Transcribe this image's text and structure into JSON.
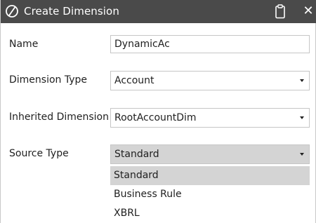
{
  "dialog": {
    "title": "Create Dimension",
    "icons": {
      "logo": "onestream-logo-icon",
      "clipboard": "clipboard-icon",
      "close": "close-icon"
    },
    "close_glyph": "✕"
  },
  "form": {
    "name": {
      "label": "Name",
      "value": "DynamicAc"
    },
    "dimension_type": {
      "label": "Dimension Type",
      "value": "Account"
    },
    "inherited_dimension": {
      "label": "Inherited Dimension",
      "value": "RootAccountDim"
    },
    "source_type": {
      "label": "Source Type",
      "value": "Standard",
      "options": [
        "Standard",
        "Business Rule",
        "XBRL"
      ]
    }
  },
  "colors": {
    "titlebar": "#4a4a4a",
    "highlight": "#d4d4d4",
    "border": "#c6c6c6"
  }
}
